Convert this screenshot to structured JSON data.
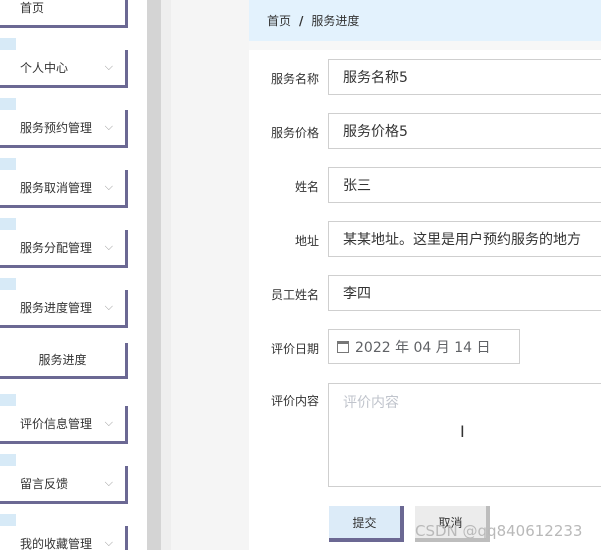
{
  "sidebar": {
    "items": [
      {
        "label": "首页"
      },
      {
        "label": "个人中心"
      },
      {
        "label": "服务预约管理"
      },
      {
        "label": "服务取消管理"
      },
      {
        "label": "服务分配管理"
      },
      {
        "label": "服务进度管理"
      },
      {
        "label": "服务进度"
      },
      {
        "label": "评价信息管理"
      },
      {
        "label": "留言反馈"
      },
      {
        "label": "我的收藏管理"
      }
    ]
  },
  "breadcrumb": {
    "home": "首页",
    "separator": "/",
    "current": "服务进度"
  },
  "form": {
    "service_name": {
      "label": "服务名称",
      "value": "服务名称5"
    },
    "service_price": {
      "label": "服务价格",
      "value": "服务价格5"
    },
    "name": {
      "label": "姓名",
      "value": "张三"
    },
    "address": {
      "label": "地址",
      "value": "某某地址。这里是用户预约服务的地方"
    },
    "staff_name": {
      "label": "员工姓名",
      "value": "李四"
    },
    "review_date": {
      "label": "评价日期",
      "value": "2022 年 04 月 14 日"
    },
    "review_content": {
      "label": "评价内容",
      "placeholder": "评价内容"
    }
  },
  "buttons": {
    "submit": "提交",
    "cancel": "取消"
  },
  "watermark": "CSDN @qq840612233",
  "colors": {
    "accent_border": "#6b6893",
    "breadcrumb_bg": "#e3f2fd",
    "submit_bg": "#dcebf8"
  }
}
